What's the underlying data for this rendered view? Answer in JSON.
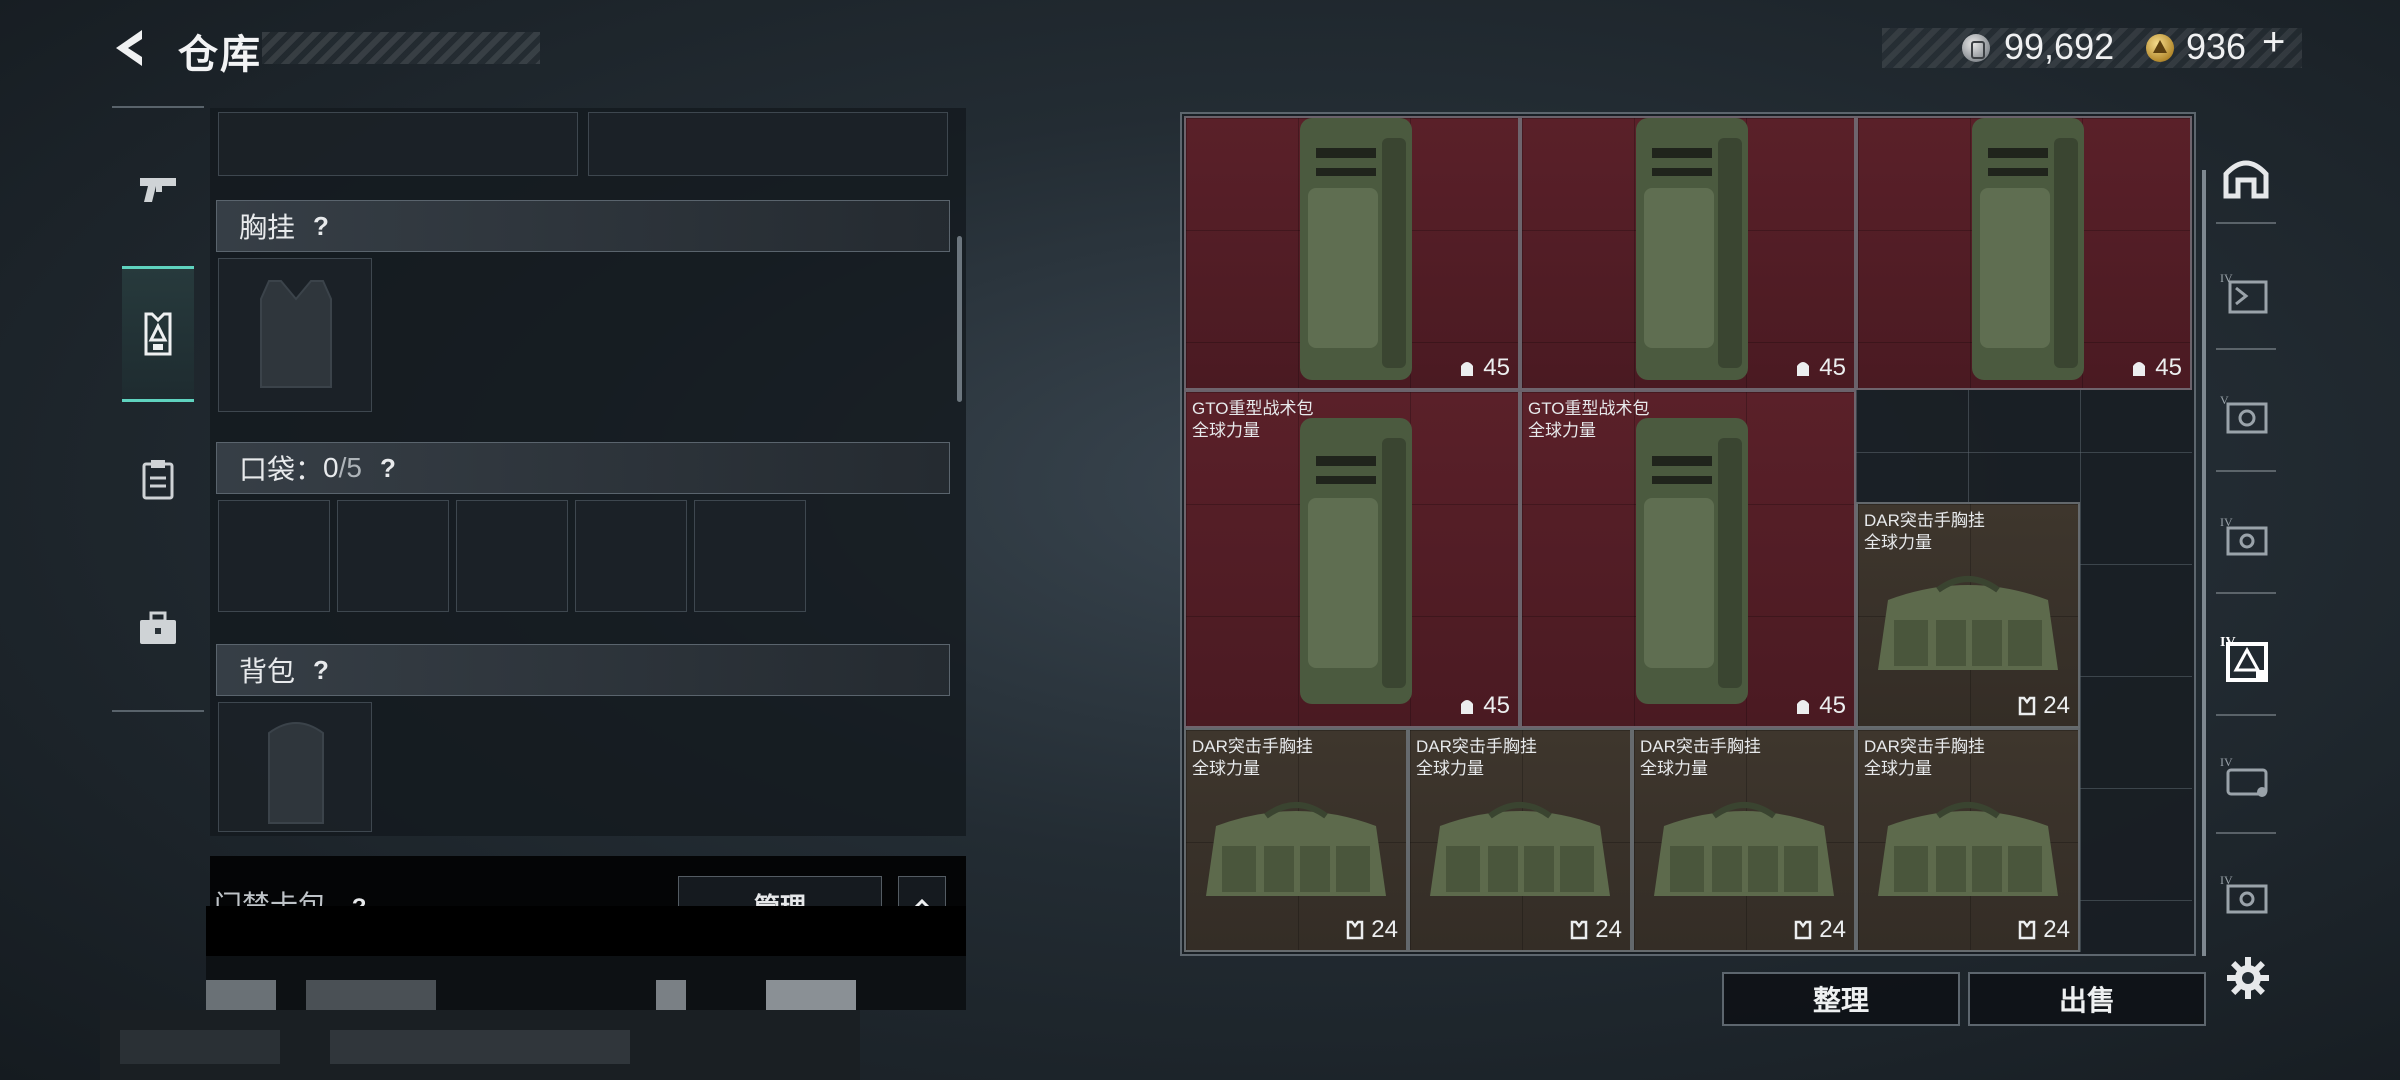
{
  "header": {
    "title": "仓库"
  },
  "currency": {
    "silver": "99,692",
    "gold": "936",
    "plus_label": "+"
  },
  "tabs": [
    {
      "name": "weapons",
      "icon": "pistol-icon"
    },
    {
      "name": "equipment",
      "icon": "vest-equipment-icon",
      "active": true
    },
    {
      "name": "consumables",
      "icon": "clipboard-icon"
    },
    {
      "name": "items",
      "icon": "briefcase-icon"
    }
  ],
  "equipment": {
    "chest_rig": {
      "label": "胸挂",
      "help": "?"
    },
    "pockets": {
      "label_prefix": "口袋：",
      "count": "0",
      "separator": "/",
      "capacity": "5",
      "help": "?"
    },
    "backpack": {
      "label": "背包",
      "help": "?"
    },
    "card_pack": {
      "label": "门禁卡包",
      "help": "?",
      "manage_label": "管理"
    }
  },
  "inventory": {
    "items": [
      {
        "type": "backpack",
        "name": "",
        "brand": "",
        "count": "45"
      },
      {
        "type": "backpack",
        "name": "",
        "brand": "",
        "count": "45"
      },
      {
        "type": "backpack",
        "name": "",
        "brand": "",
        "count": "45"
      },
      {
        "type": "backpack",
        "name": "GTO重型战术包",
        "brand": "全球力量",
        "count": "45"
      },
      {
        "type": "backpack",
        "name": "GTO重型战术包",
        "brand": "全球力量",
        "count": "45"
      },
      {
        "type": "chest_rig",
        "name": "DAR突击手胸挂",
        "brand": "全球力量",
        "count": "24"
      },
      {
        "type": "chest_rig",
        "name": "DAR突击手胸挂",
        "brand": "全球力量",
        "count": "24"
      },
      {
        "type": "chest_rig",
        "name": "DAR突击手胸挂",
        "brand": "全球力量",
        "count": "24"
      },
      {
        "type": "chest_rig",
        "name": "DAR突击手胸挂",
        "brand": "全球力量",
        "count": "24"
      },
      {
        "type": "chest_rig",
        "name": "DAR突击手胸挂",
        "brand": "全球力量",
        "count": "24"
      }
    ]
  },
  "filters": [
    "all-icon",
    "tier-iv-backpack-icon",
    "tier-v-chest-rig-icon",
    "tier-iv-chest-rig-icon",
    "tier-iv-bag-active-icon",
    "tier-iv-helmet-icon",
    "tier-iv-armor-icon"
  ],
  "actions": {
    "sort_label": "整理",
    "sell_label": "出售"
  },
  "colors": {
    "accent": "#5fd3bf",
    "backpack_bg": "#5a2029",
    "rig_bg": "#3e362d"
  }
}
